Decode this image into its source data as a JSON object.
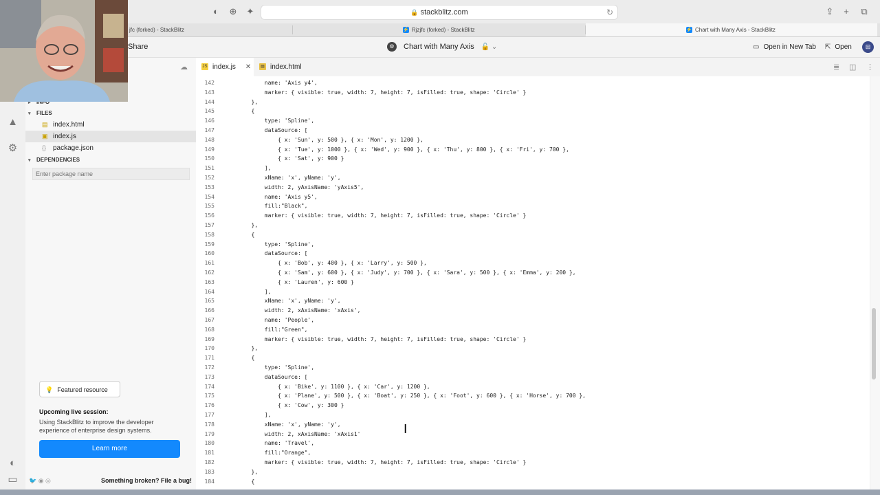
{
  "browser": {
    "url": "stackblitz.com",
    "tabs": [
      {
        "label": "jfc (forked) - StackBlitz"
      },
      {
        "label": "Rjzjfc (forked) - StackBlitz"
      },
      {
        "label": "Chart with Many Axis - StackBlitz"
      }
    ]
  },
  "header": {
    "share": "Share",
    "project_title": "Chart with Many Axis",
    "open_new_tab": "Open in New Tab",
    "open": "Open"
  },
  "sidebar": {
    "info_label": "INFO",
    "files_label": "FILES",
    "files": [
      {
        "name": "index.html"
      },
      {
        "name": "index.js"
      },
      {
        "name": "package.json"
      }
    ],
    "dependencies_label": "DEPENDENCIES",
    "package_placeholder": "Enter package name",
    "featured": "Featured resource",
    "upcoming_title": "Upcoming live session:",
    "upcoming_desc": "Using StackBlitz to improve the developer experience of enterprise design systems.",
    "learn_more": "Learn more",
    "bug_text": "Something broken? File a bug!"
  },
  "editor_tabs": [
    {
      "name": "index.js"
    },
    {
      "name": "index.html"
    }
  ],
  "code": [
    {
      "n": "142",
      "t": "            name: 'Axis y4',"
    },
    {
      "n": "143",
      "t": "            marker: { visible: true, width: 7, height: 7, isFilled: true, shape: 'Circle' }"
    },
    {
      "n": "144",
      "t": "        },"
    },
    {
      "n": "145",
      "t": "        {"
    },
    {
      "n": "146",
      "t": "            type: 'Spline',"
    },
    {
      "n": "147",
      "t": "            dataSource: ["
    },
    {
      "n": "148",
      "t": "                { x: 'Sun', y: 500 }, { x: 'Mon', y: 1200 },"
    },
    {
      "n": "149",
      "t": "                { x: 'Tue', y: 1000 }, { x: 'Wed', y: 900 }, { x: 'Thu', y: 800 }, { x: 'Fri', y: 700 },"
    },
    {
      "n": "150",
      "t": "                { x: 'Sat', y: 900 }"
    },
    {
      "n": "151",
      "t": "            ],"
    },
    {
      "n": "152",
      "t": "            xName: 'x', yName: 'y',"
    },
    {
      "n": "153",
      "t": "            width: 2, yAxisName: 'yAxis5',"
    },
    {
      "n": "154",
      "t": "            name: 'Axis y5',"
    },
    {
      "n": "155",
      "t": "            fill:\"Black\","
    },
    {
      "n": "156",
      "t": "            marker: { visible: true, width: 7, height: 7, isFilled: true, shape: 'Circle' }"
    },
    {
      "n": "157",
      "t": "        },"
    },
    {
      "n": "158",
      "t": "        {"
    },
    {
      "n": "159",
      "t": "            type: 'Spline',"
    },
    {
      "n": "160",
      "t": "            dataSource: ["
    },
    {
      "n": "161",
      "t": "                { x: 'Bob', y: 400 }, { x: 'Larry', y: 500 },"
    },
    {
      "n": "162",
      "t": "                { x: 'Sam', y: 600 }, { x: 'Judy', y: 700 }, { x: 'Sara', y: 500 }, { x: 'Emma', y: 200 },"
    },
    {
      "n": "163",
      "t": "                { x: 'Lauren', y: 600 }"
    },
    {
      "n": "164",
      "t": "            ],"
    },
    {
      "n": "165",
      "t": "            xName: 'x', yName: 'y',"
    },
    {
      "n": "166",
      "t": "            width: 2, xAxisName: 'xAxis',"
    },
    {
      "n": "167",
      "t": "            name: 'People',"
    },
    {
      "n": "168",
      "t": "            fill:\"Green\","
    },
    {
      "n": "169",
      "t": "            marker: { visible: true, width: 7, height: 7, isFilled: true, shape: 'Circle' }"
    },
    {
      "n": "170",
      "t": "        },"
    },
    {
      "n": "171",
      "t": "        {"
    },
    {
      "n": "172",
      "t": "            type: 'Spline',"
    },
    {
      "n": "173",
      "t": "            dataSource: ["
    },
    {
      "n": "174",
      "t": "                { x: 'Bike', y: 1100 }, { x: 'Car', y: 1200 },"
    },
    {
      "n": "175",
      "t": "                { x: 'Plane', y: 500 }, { x: 'Boat', y: 250 }, { x: 'Foot', y: 600 }, { x: 'Horse', y: 700 },"
    },
    {
      "n": "176",
      "t": "                { x: 'Cow', y: 300 }"
    },
    {
      "n": "177",
      "t": "            ],"
    },
    {
      "n": "178",
      "t": "            xName: 'x', yName: 'y',"
    },
    {
      "n": "179",
      "t": "            width: 2, xAxisName: 'xAxis1'"
    },
    {
      "n": "180",
      "t": "            name: 'Travel',"
    },
    {
      "n": "181",
      "t": "            fill:\"Orange\","
    },
    {
      "n": "182",
      "t": "            marker: { visible: true, width: 7, height: 7, isFilled: true, shape: 'Circle' }"
    },
    {
      "n": "183",
      "t": "        },"
    },
    {
      "n": "184",
      "t": "        {"
    }
  ]
}
